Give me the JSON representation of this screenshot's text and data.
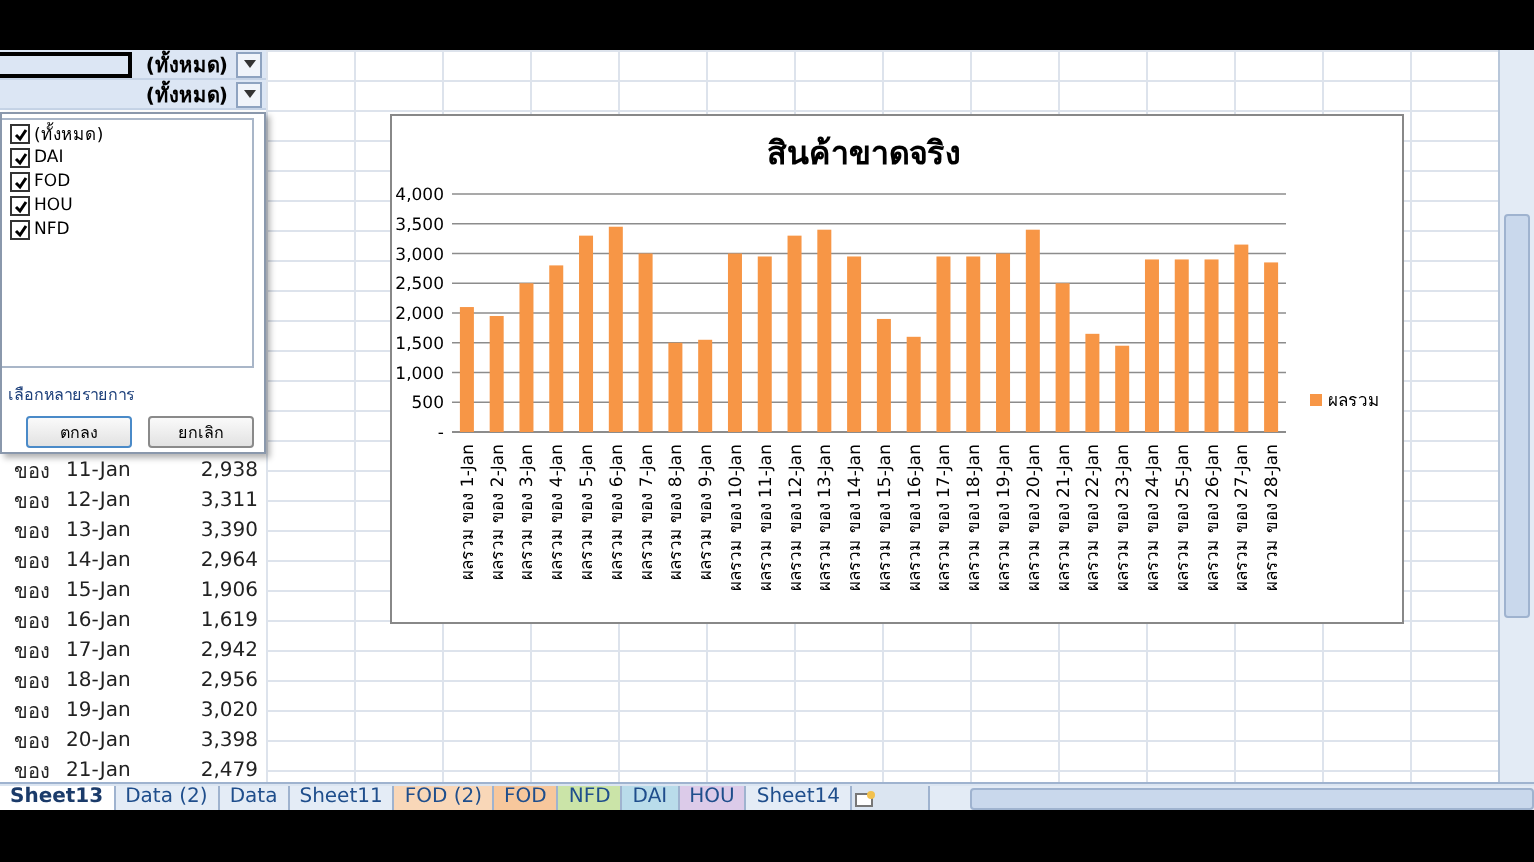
{
  "filter_rows": [
    {
      "value": "(ทั้งหมด)"
    },
    {
      "value": "(ทั้งหมด)"
    }
  ],
  "filter_dropdown": {
    "items": [
      {
        "label": "(ทั้งหมด)",
        "checked": true
      },
      {
        "label": "DAI",
        "checked": true
      },
      {
        "label": "FOD",
        "checked": true
      },
      {
        "label": "HOU",
        "checked": true
      },
      {
        "label": "NFD",
        "checked": true
      }
    ],
    "multi_select_label": "เลือกหลายรายการ",
    "buttons": [
      "ตกลง",
      "ยกเลิก"
    ]
  },
  "table": {
    "rows": [
      {
        "column_1": "ของ",
        "column_2": "11-Jan",
        "column_3": "2,938"
      },
      {
        "column_1": "ของ",
        "column_2": "12-Jan",
        "column_3": "3,311"
      },
      {
        "column_1": "ของ",
        "column_2": "13-Jan",
        "column_3": "3,390"
      },
      {
        "column_1": "ของ",
        "column_2": "14-Jan",
        "column_3": "2,964"
      },
      {
        "column_1": "ของ",
        "column_2": "15-Jan",
        "column_3": "1,906"
      },
      {
        "column_1": "ของ",
        "column_2": "16-Jan",
        "column_3": "1,619"
      },
      {
        "column_1": "ของ",
        "column_2": "17-Jan",
        "column_3": "2,942"
      },
      {
        "column_1": "ของ",
        "column_2": "18-Jan",
        "column_3": "2,956"
      },
      {
        "column_1": "ของ",
        "column_2": "19-Jan",
        "column_3": "3,020"
      },
      {
        "column_1": "ของ",
        "column_2": "20-Jan",
        "column_3": "3,398"
      },
      {
        "column_1": "ของ",
        "column_2": "21-Jan",
        "column_3": "2,479"
      }
    ]
  },
  "chart": {
    "chart_data": {
      "type": "bar",
      "title": "สินค้าขาดจริง",
      "categories": [
        "ผลรวม ของ 1-Jan",
        "ผลรวม ของ 2-Jan",
        "ผลรวม ของ 3-Jan",
        "ผลรวม ของ 4-Jan",
        "ผลรวม ของ 5-Jan",
        "ผลรวม ของ 6-Jan",
        "ผลรวม ของ 7-Jan",
        "ผลรวม ของ 8-Jan",
        "ผลรวม ของ 9-Jan",
        "ผลรวม ของ 10-Jan",
        "ผลรวม ของ 11-Jan",
        "ผลรวม ของ 12-Jan",
        "ผลรวม ของ 13-Jan",
        "ผลรวม ของ 14-Jan",
        "ผลรวม ของ 15-Jan",
        "ผลรวม ของ 16-Jan",
        "ผลรวม ของ 17-Jan",
        "ผลรวม ของ 18-Jan",
        "ผลรวม ของ 19-Jan",
        "ผลรวม ของ 20-Jan",
        "ผลรวม ของ 21-Jan",
        "ผลรวม ของ 22-Jan",
        "ผลรวม ของ 23-Jan",
        "ผลรวม ของ 24-Jan",
        "ผลรวม ของ 25-Jan",
        "ผลรวม ของ 26-Jan",
        "ผลรวม ของ 27-Jan",
        "ผลรวม ของ 28-Jan"
      ],
      "series": [
        {
          "name": "ผลรวม",
          "color": "#f79646",
          "values": [
            2100,
            1950,
            2500,
            2800,
            3300,
            3450,
            3000,
            1500,
            1550,
            3000,
            2950,
            3300,
            3400,
            2950,
            1900,
            1600,
            2950,
            2950,
            3000,
            3400,
            2500,
            1650,
            1450,
            2900,
            2900,
            2900,
            3150,
            2850
          ]
        }
      ],
      "grid": true,
      "ylim": [
        0,
        4000
      ],
      "yticks": [
        {
          "value": 0,
          "label": "-"
        },
        {
          "value": 500,
          "label": "500"
        },
        {
          "value": 1000,
          "label": "1,000"
        },
        {
          "value": 1500,
          "label": "1,500"
        },
        {
          "value": 2000,
          "label": "2,000"
        },
        {
          "value": 2500,
          "label": "2,500"
        },
        {
          "value": 3000,
          "label": "3,000"
        },
        {
          "value": 3500,
          "label": "3,500"
        },
        {
          "value": 4000,
          "label": "4,000"
        }
      ]
    }
  },
  "sheet_tabs": [
    {
      "label": "Sheet13",
      "selected": true
    },
    {
      "label": "Data (2)",
      "selected": false
    },
    {
      "label": "Data",
      "selected": false
    },
    {
      "label": "Sheet11",
      "selected": false
    },
    {
      "label": "FOD (2)",
      "selected": false,
      "color": "#f9d7b8"
    },
    {
      "label": "FOD",
      "selected": false,
      "color": "#f7c79c"
    },
    {
      "label": "NFD",
      "selected": false,
      "color": "#cbe4a8"
    },
    {
      "label": "DAI",
      "selected": false,
      "color": "#b9dcea"
    },
    {
      "label": "HOU",
      "selected": false,
      "color": "#dccbe9"
    },
    {
      "label": "Sheet14",
      "selected": false
    }
  ]
}
